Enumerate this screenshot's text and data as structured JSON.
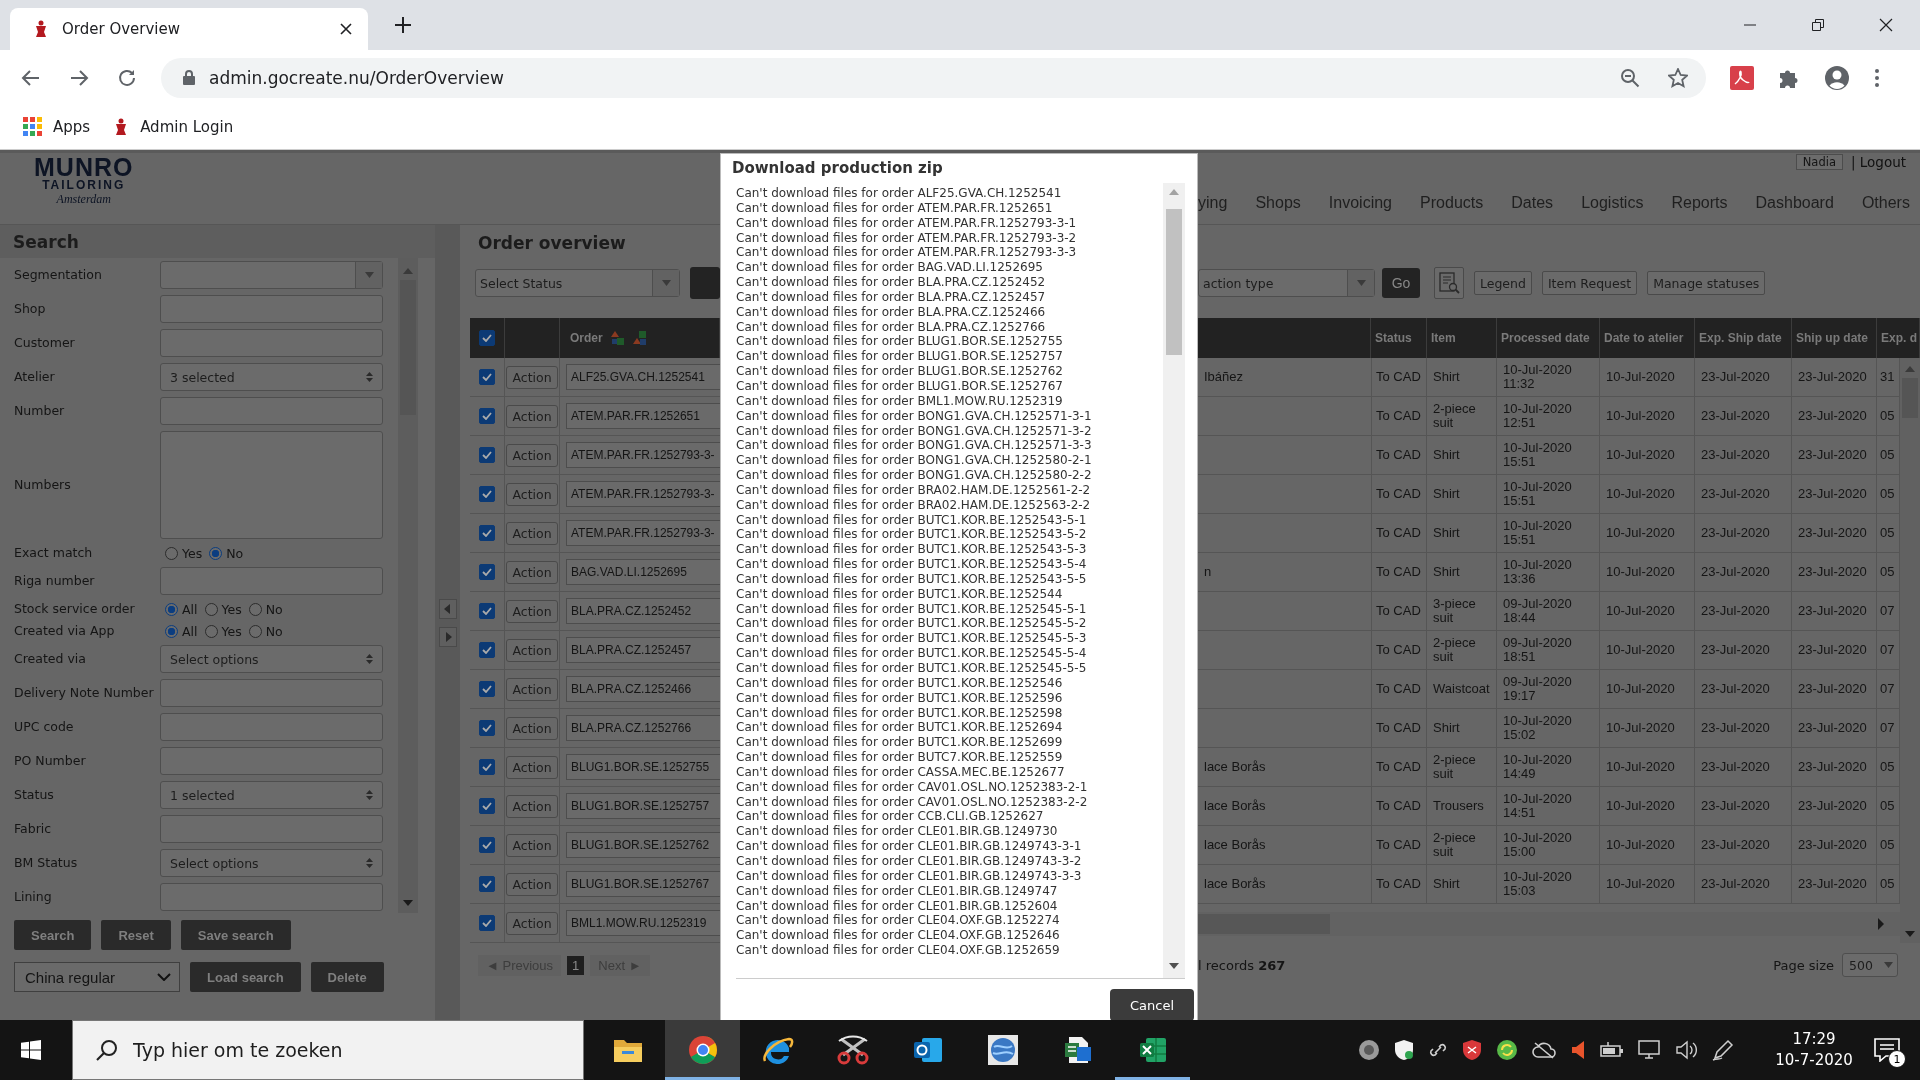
{
  "browser": {
    "tab_title": "Order Overview",
    "url": "admin.gocreate.nu/OrderOverview",
    "bookmarks": [
      "Apps",
      "Admin Login"
    ]
  },
  "header": {
    "logo": {
      "wordmark": "MUNRO",
      "subtitle": "TAILORING",
      "script": "Amsterdam"
    },
    "user": "Nadia",
    "logout": "| Logout",
    "nav": [
      "ying",
      "Shops",
      "Invoicing",
      "Products",
      "Dates",
      "Logistics",
      "Reports",
      "Dashboard",
      "Others"
    ]
  },
  "search_panel": {
    "title": "Search",
    "fields": [
      {
        "kind": "dropdown",
        "label": "Segmentation"
      },
      {
        "kind": "text",
        "label": "Shop"
      },
      {
        "kind": "text",
        "label": "Customer"
      },
      {
        "kind": "select",
        "label": "Atelier",
        "value": "3 selected"
      },
      {
        "kind": "text",
        "label": "Number"
      },
      {
        "kind": "textarea",
        "label": "Numbers"
      },
      {
        "kind": "radio",
        "label": "Exact match",
        "options": [
          {
            "label": "Yes",
            "selected": false
          },
          {
            "label": "No",
            "selected": true
          }
        ]
      },
      {
        "kind": "text",
        "label": "Riga number"
      },
      {
        "kind": "radio",
        "label": "Stock service order",
        "options": [
          {
            "label": "All",
            "selected": true
          },
          {
            "label": "Yes",
            "selected": false
          },
          {
            "label": "No",
            "selected": false
          }
        ]
      },
      {
        "kind": "radio",
        "label": "Created via App",
        "options": [
          {
            "label": "All",
            "selected": true
          },
          {
            "label": "Yes",
            "selected": false
          },
          {
            "label": "No",
            "selected": false
          }
        ]
      },
      {
        "kind": "select",
        "label": "Created via",
        "value": "Select options"
      },
      {
        "kind": "text",
        "label": "Delivery Note Number"
      },
      {
        "kind": "text",
        "label": "UPC code"
      },
      {
        "kind": "text",
        "label": "PO Number"
      },
      {
        "kind": "select",
        "label": "Status",
        "value": "1 selected"
      },
      {
        "kind": "text",
        "label": "Fabric"
      },
      {
        "kind": "select",
        "label": "BM Status",
        "value": "Select options"
      },
      {
        "kind": "text",
        "label": "Lining"
      }
    ],
    "buttons": [
      "Search",
      "Reset",
      "Save search"
    ],
    "saved_search": "China regular",
    "saved_buttons": [
      "Load search",
      "Delete"
    ]
  },
  "main": {
    "title": "Order overview",
    "status_select": "Select Status",
    "action_select": "action type",
    "buttons": [
      {
        "kind": "primary",
        "label": "Go"
      },
      {
        "kind": "icon"
      },
      {
        "kind": "outline",
        "label": "Legend"
      },
      {
        "kind": "outline",
        "label": "Item Request"
      },
      {
        "kind": "outline",
        "label": "Manage statuses"
      }
    ]
  },
  "table": {
    "all_checked": true,
    "columns": [
      "Order",
      "Status",
      "Item",
      "Processed date",
      "Date to atelier",
      "Exp. Ship date",
      "Ship up date",
      "Exp. d"
    ],
    "rows": [
      {
        "checked": true,
        "action": "Action",
        "order": "ALF25.GVA.CH.1252541",
        "column_4": "Ibáñez",
        "cells": [
          "To CAD",
          "Shirt",
          "10-Jul-2020 11:32",
          "10-Jul-2020",
          "23-Jul-2020",
          "23-Jul-2020",
          "31"
        ]
      },
      {
        "checked": true,
        "action": "Action",
        "order": "ATEM.PAR.FR.1252651",
        "cells": [
          "To CAD",
          "2-piece suit",
          "10-Jul-2020 12:51",
          "10-Jul-2020",
          "23-Jul-2020",
          "23-Jul-2020",
          "05"
        ]
      },
      {
        "checked": true,
        "action": "Action",
        "order": "ATEM.PAR.FR.1252793-3-",
        "cells": [
          "To CAD",
          "Shirt",
          "10-Jul-2020 15:51",
          "10-Jul-2020",
          "23-Jul-2020",
          "23-Jul-2020",
          "05"
        ]
      },
      {
        "checked": true,
        "action": "Action",
        "order": "ATEM.PAR.FR.1252793-3-",
        "cells": [
          "To CAD",
          "Shirt",
          "10-Jul-2020 15:51",
          "10-Jul-2020",
          "23-Jul-2020",
          "23-Jul-2020",
          "05"
        ]
      },
      {
        "checked": true,
        "action": "Action",
        "order": "ATEM.PAR.FR.1252793-3-",
        "cells": [
          "To CAD",
          "Shirt",
          "10-Jul-2020 15:51",
          "10-Jul-2020",
          "23-Jul-2020",
          "23-Jul-2020",
          "05"
        ]
      },
      {
        "checked": true,
        "action": "Action",
        "order": "BAG.VAD.LI.1252695",
        "column_4": "n",
        "cells": [
          "To CAD",
          "Shirt",
          "10-Jul-2020 13:36",
          "10-Jul-2020",
          "23-Jul-2020",
          "23-Jul-2020",
          "05"
        ]
      },
      {
        "checked": true,
        "action": "Action",
        "order": "BLA.PRA.CZ.1252452",
        "cells": [
          "To CAD",
          "3-piece suit",
          "09-Jul-2020 18:44",
          "10-Jul-2020",
          "23-Jul-2020",
          "23-Jul-2020",
          "07"
        ]
      },
      {
        "checked": true,
        "action": "Action",
        "order": "BLA.PRA.CZ.1252457",
        "cells": [
          "To CAD",
          "2-piece suit",
          "09-Jul-2020 18:51",
          "10-Jul-2020",
          "23-Jul-2020",
          "23-Jul-2020",
          "07"
        ]
      },
      {
        "checked": true,
        "action": "Action",
        "order": "BLA.PRA.CZ.1252466",
        "cells": [
          "To CAD",
          "Waistcoat",
          "09-Jul-2020 19:17",
          "10-Jul-2020",
          "23-Jul-2020",
          "23-Jul-2020",
          "07"
        ]
      },
      {
        "checked": true,
        "action": "Action",
        "order": "BLA.PRA.CZ.1252766",
        "cells": [
          "To CAD",
          "Shirt",
          "10-Jul-2020 15:02",
          "10-Jul-2020",
          "23-Jul-2020",
          "23-Jul-2020",
          "07"
        ]
      },
      {
        "checked": true,
        "action": "Action",
        "order": "BLUG1.BOR.SE.1252755",
        "column_4": "lace Borås",
        "cells": [
          "To CAD",
          "2-piece suit",
          "10-Jul-2020 14:49",
          "10-Jul-2020",
          "23-Jul-2020",
          "23-Jul-2020",
          "05"
        ]
      },
      {
        "checked": true,
        "action": "Action",
        "order": "BLUG1.BOR.SE.1252757",
        "column_4": "lace Borås",
        "cells": [
          "To CAD",
          "Trousers",
          "10-Jul-2020 14:51",
          "10-Jul-2020",
          "23-Jul-2020",
          "23-Jul-2020",
          "05"
        ]
      },
      {
        "checked": true,
        "action": "Action",
        "order": "BLUG1.BOR.SE.1252762",
        "column_4": "lace Borås",
        "cells": [
          "To CAD",
          "2-piece suit",
          "10-Jul-2020 15:00",
          "10-Jul-2020",
          "23-Jul-2020",
          "23-Jul-2020",
          "05"
        ]
      },
      {
        "checked": true,
        "action": "Action",
        "order": "BLUG1.BOR.SE.1252767",
        "column_4": "lace Borås",
        "cells": [
          "To CAD",
          "Shirt",
          "10-Jul-2020 15:03",
          "10-Jul-2020",
          "23-Jul-2020",
          "23-Jul-2020",
          "05"
        ]
      },
      {
        "checked": true,
        "action": "Action",
        "order": "BML1.MOW.RU.1252319"
      }
    ]
  },
  "pager": {
    "previous": "◄ Previous",
    "pages": [
      {
        "label": "1",
        "selected": true
      }
    ],
    "next": "Next ►",
    "total": "l records **267**",
    "page_size_label": "Page size",
    "page_size": "500"
  },
  "dialog": {
    "title": "Download production zip",
    "messages": [
      "Can't download files for order ALF25.GVA.CH.1252541",
      "Can't download files for order ATEM.PAR.FR.1252651",
      "Can't download files for order ATEM.PAR.FR.1252793-3-1",
      "Can't download files for order ATEM.PAR.FR.1252793-3-2",
      "Can't download files for order ATEM.PAR.FR.1252793-3-3",
      "Can't download files for order BAG.VAD.LI.1252695",
      "Can't download files for order BLA.PRA.CZ.1252452",
      "Can't download files for order BLA.PRA.CZ.1252457",
      "Can't download files for order BLA.PRA.CZ.1252466",
      "Can't download files for order BLA.PRA.CZ.1252766",
      "Can't download files for order BLUG1.BOR.SE.1252755",
      "Can't download files for order BLUG1.BOR.SE.1252757",
      "Can't download files for order BLUG1.BOR.SE.1252762",
      "Can't download files for order BLUG1.BOR.SE.1252767",
      "Can't download files for order BML1.MOW.RU.1252319",
      "Can't download files for order BONG1.GVA.CH.1252571-3-1",
      "Can't download files for order BONG1.GVA.CH.1252571-3-2",
      "Can't download files for order BONG1.GVA.CH.1252571-3-3",
      "Can't download files for order BONG1.GVA.CH.1252580-2-1",
      "Can't download files for order BONG1.GVA.CH.1252580-2-2",
      "Can't download files for order BRA02.HAM.DE.1252561-2-2",
      "Can't download files for order BRA02.HAM.DE.1252563-2-2",
      "Can't download files for order BUTC1.KOR.BE.1252543-5-1",
      "Can't download files for order BUTC1.KOR.BE.1252543-5-2",
      "Can't download files for order BUTC1.KOR.BE.1252543-5-3",
      "Can't download files for order BUTC1.KOR.BE.1252543-5-4",
      "Can't download files for order BUTC1.KOR.BE.1252543-5-5",
      "Can't download files for order BUTC1.KOR.BE.1252544",
      "Can't download files for order BUTC1.KOR.BE.1252545-5-1",
      "Can't download files for order BUTC1.KOR.BE.1252545-5-2",
      "Can't download files for order BUTC1.KOR.BE.1252545-5-3",
      "Can't download files for order BUTC1.KOR.BE.1252545-5-4",
      "Can't download files for order BUTC1.KOR.BE.1252545-5-5",
      "Can't download files for order BUTC1.KOR.BE.1252546",
      "Can't download files for order BUTC1.KOR.BE.1252596",
      "Can't download files for order BUTC1.KOR.BE.1252598",
      "Can't download files for order BUTC1.KOR.BE.1252694",
      "Can't download files for order BUTC1.KOR.BE.1252699",
      "Can't download files for order BUTC7.KOR.BE.1252559",
      "Can't download files for order CASSA.MEC.BE.1252677",
      "Can't download files for order CAV01.OSL.NO.1252383-2-1",
      "Can't download files for order CAV01.OSL.NO.1252383-2-2",
      "Can't download files for order CCB.CLI.GB.1252627",
      "Can't download files for order CLE01.BIR.GB.1249730",
      "Can't download files for order CLE01.BIR.GB.1249743-3-1",
      "Can't download files for order CLE01.BIR.GB.1249743-3-2",
      "Can't download files for order CLE01.BIR.GB.1249743-3-3",
      "Can't download files for order CLE01.BIR.GB.1249747",
      "Can't download files for order CLE01.BIR.GB.1252604",
      "Can't download files for order CLE04.OXF.GB.1252274",
      "Can't download files for order CLE04.OXF.GB.1252646",
      "Can't download files for order CLE04.OXF.GB.1252659"
    ],
    "button": "Cancel"
  },
  "taskbar": {
    "search_placeholder": "Typ hier om te zoeken",
    "apps": [
      {
        "kind": "folder",
        "selected": false,
        "running": false
      },
      {
        "kind": "browser",
        "selected": true,
        "running": true
      },
      {
        "kind": "e_browser",
        "selected": false,
        "running": false
      },
      {
        "kind": "scissors",
        "selected": false,
        "running": false
      },
      {
        "kind": "mail",
        "selected": false,
        "running": false
      },
      {
        "kind": "app",
        "selected": false,
        "running": false
      },
      {
        "kind": "file",
        "selected": false,
        "running": false
      },
      {
        "kind": "spreadsheet",
        "selected": false,
        "running": true
      }
    ],
    "time": "17:29",
    "date": "10-7-2020",
    "notifications": "1"
  }
}
